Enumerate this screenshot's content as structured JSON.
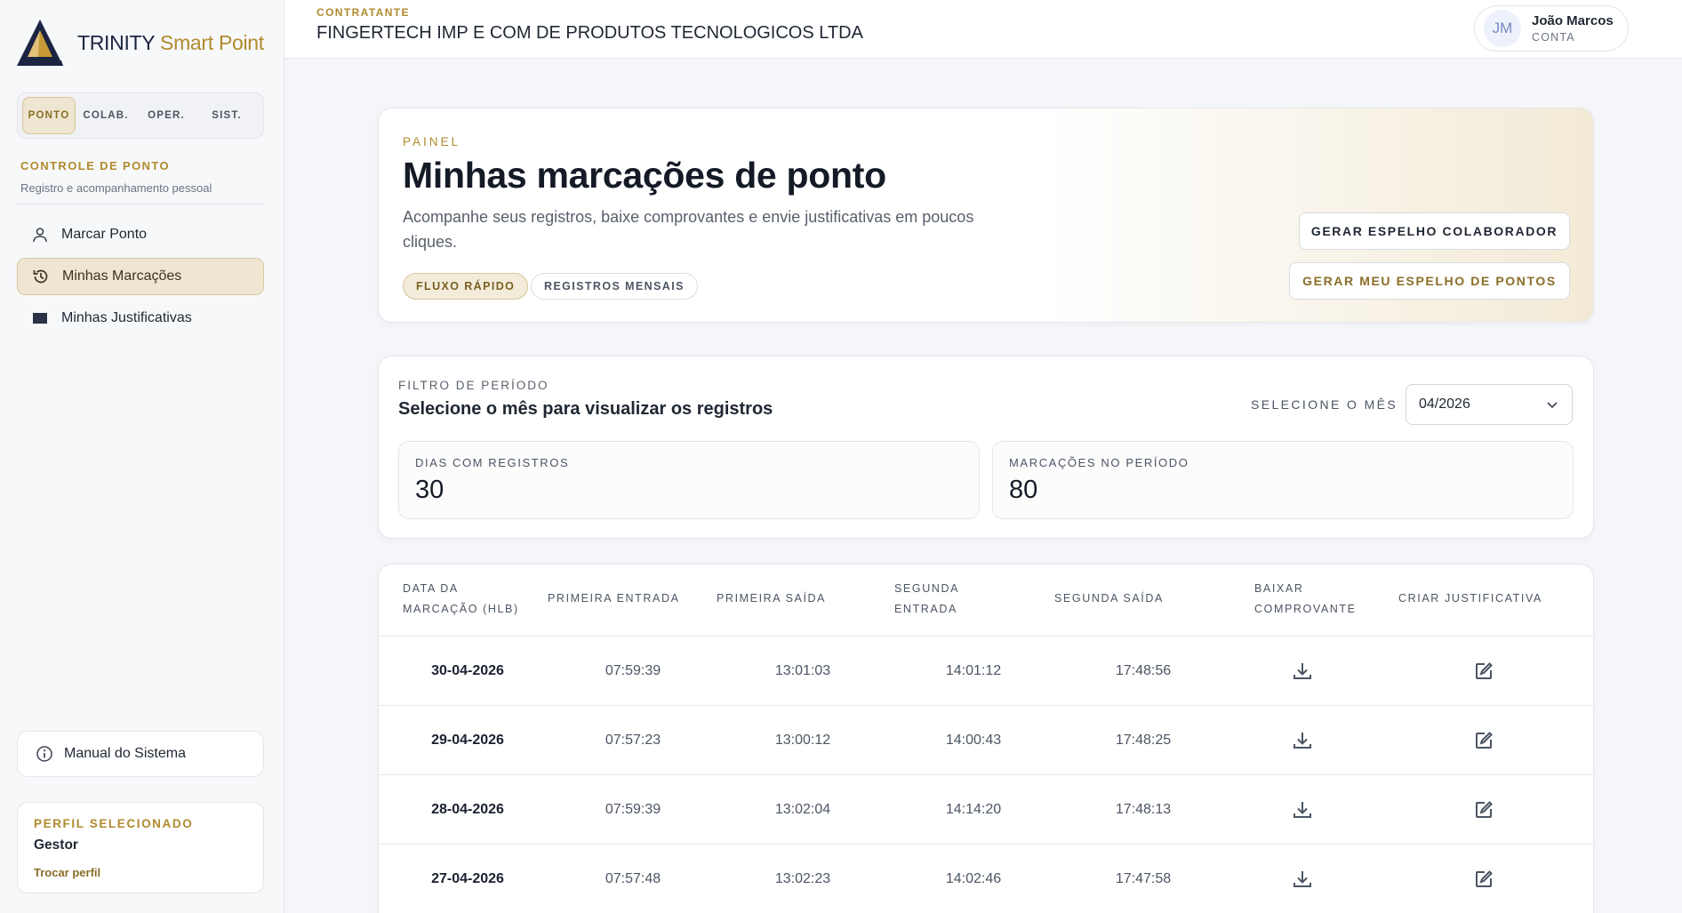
{
  "brand": {
    "name_main": "TRINITY",
    "name_accent": "Smart Point"
  },
  "segments": [
    "PONTO",
    "COLAB.",
    "OPER.",
    "SIST."
  ],
  "sidebar": {
    "section_title": "CONTROLE DE PONTO",
    "section_sub": "Registro e acompanhamento pessoal",
    "items": [
      {
        "label": "Marcar Ponto",
        "icon": "user-icon"
      },
      {
        "label": "Minhas Marcações",
        "icon": "history-icon",
        "active": true
      },
      {
        "label": "Minhas Justificativas",
        "icon": "folder-icon"
      }
    ],
    "manual": "Manual do Sistema",
    "profile": {
      "label": "PERFIL SELECIONADO",
      "value": "Gestor",
      "change": "Trocar perfil"
    }
  },
  "header": {
    "label": "CONTRATANTE",
    "company": "FINGERTECH IMP E COM DE PRODUTOS TECNOLOGICOS LTDA",
    "user": {
      "initials": "JM",
      "name": "João Marcos",
      "role": "CONTA"
    }
  },
  "hero": {
    "kicker": "PAINEL",
    "title": "Minhas marcações de ponto",
    "description": "Acompanhe seus registros, baixe comprovantes e envie justificativas em poucos cliques.",
    "chips": [
      "FLUXO RÁPIDO",
      "REGISTROS MENSAIS"
    ],
    "btn_colaborador": "GERAR ESPELHO COLABORADOR",
    "btn_meu": "GERAR MEU ESPELHO DE PONTOS"
  },
  "filter": {
    "kicker": "FILTRO DE PERÍODO",
    "title": "Selecione o mês para visualizar os registros",
    "select_label": "SELECIONE O MÊS",
    "select_value": "04/2026",
    "stats": [
      {
        "label": "DIAS COM REGISTROS",
        "value": "30"
      },
      {
        "label": "MARCAÇÕES NO PERÍODO",
        "value": "80"
      }
    ]
  },
  "table": {
    "headers": [
      "DATA DA\nMARCAÇÃO (HLB)",
      "PRIMEIRA ENTRADA",
      "PRIMEIRA SAÍDA",
      "SEGUNDA\nENTRADA",
      "SEGUNDA SAÍDA",
      "BAIXAR\nCOMPROVANTE",
      "CRIAR JUSTIFICATIVA"
    ],
    "rows": [
      [
        "30-04-2026",
        "07:59:39",
        "13:01:03",
        "14:01:12",
        "17:48:56"
      ],
      [
        "29-04-2026",
        "07:57:23",
        "13:00:12",
        "14:00:43",
        "17:48:25"
      ],
      [
        "28-04-2026",
        "07:59:39",
        "13:02:04",
        "14:14:20",
        "17:48:13"
      ],
      [
        "27-04-2026",
        "07:57:48",
        "13:02:23",
        "14:02:46",
        "17:47:58"
      ]
    ]
  },
  "colors": {
    "gold": "#b08a2e",
    "gold_bg": "#efe6d1",
    "navy": "#1b2440"
  }
}
